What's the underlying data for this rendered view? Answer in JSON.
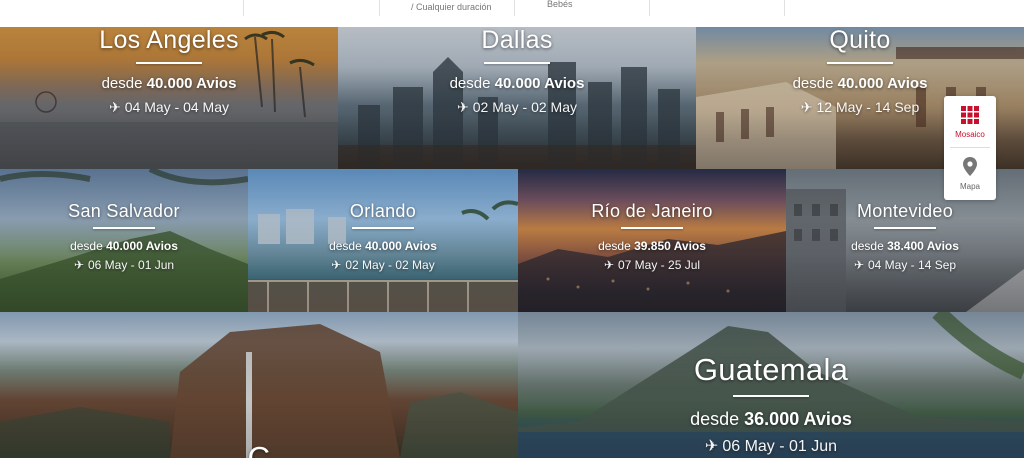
{
  "filters": {
    "duration_hint": "/ Cualquier duración",
    "babies_label": "Bebés"
  },
  "destinations": [
    {
      "city": "Los Angeles",
      "price_prefix": "desde",
      "price": "40.000 Avios",
      "dates": "04 May - 04 May"
    },
    {
      "city": "Dallas",
      "price_prefix": "desde",
      "price": "40.000 Avios",
      "dates": "02 May - 02 May"
    },
    {
      "city": "Quito",
      "price_prefix": "desde",
      "price": "40.000 Avios",
      "dates": "12 May - 14 Sep"
    },
    {
      "city": "San Salvador",
      "price_prefix": "desde",
      "price": "40.000 Avios",
      "dates": "06 May - 01 Jun"
    },
    {
      "city": "Orlando",
      "price_prefix": "desde",
      "price": "40.000 Avios",
      "dates": "02 May - 02 May"
    },
    {
      "city": "Río de Janeiro",
      "price_prefix": "desde",
      "price": "39.850 Avios",
      "dates": "07 May - 25 Jul"
    },
    {
      "city": "Montevideo",
      "price_prefix": "desde",
      "price": "38.400 Avios",
      "dates": "04 May - 14 Sep"
    },
    {
      "city": "C",
      "price_prefix": "",
      "price": "",
      "dates": ""
    },
    {
      "city": "Guatemala",
      "price_prefix": "desde",
      "price": "36.000 Avios",
      "dates": "06 May - 01 Jun"
    }
  ],
  "view_toggle": {
    "mosaic_label": "Mosaico",
    "map_label": "Mapa",
    "mosaic_icon": "grid-icon",
    "map_icon": "map-pin-icon",
    "active_color": "#c8102e"
  }
}
